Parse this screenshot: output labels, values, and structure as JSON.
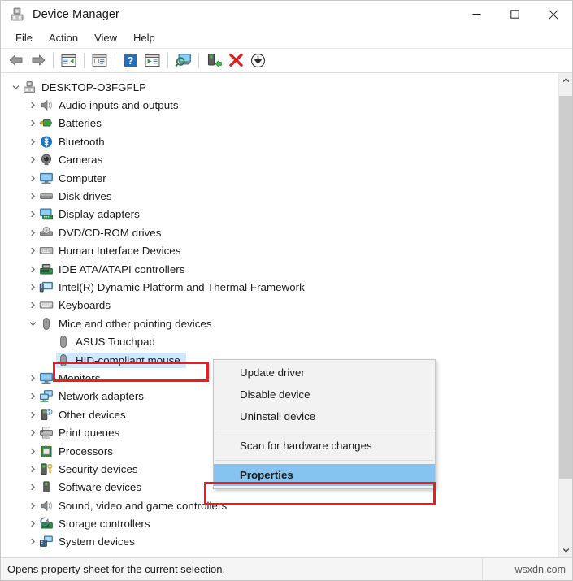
{
  "window": {
    "title": "Device Manager",
    "app_icon": "device-manager-icon",
    "caption": {
      "minimize": "minimize-icon",
      "maximize": "maximize-icon",
      "close": "close-icon"
    }
  },
  "menubar": {
    "items": [
      {
        "label": "File"
      },
      {
        "label": "Action"
      },
      {
        "label": "View"
      },
      {
        "label": "Help"
      }
    ]
  },
  "toolbar": {
    "buttons": [
      {
        "name": "back-icon",
        "tip": "Back"
      },
      {
        "name": "forward-icon",
        "tip": "Forward"
      },
      {
        "name": "show-hide-console-tree-icon",
        "tip": "Show/Hide Console Tree"
      },
      {
        "name": "properties-icon",
        "tip": "Properties"
      },
      {
        "name": "help-icon",
        "tip": "Help"
      },
      {
        "name": "update-driver-icon",
        "tip": "Update Driver"
      },
      {
        "name": "scan-for-hardware-changes-icon",
        "tip": "Scan for hardware changes"
      },
      {
        "name": "enable-device-icon",
        "tip": "Enable device"
      },
      {
        "name": "uninstall-device-icon",
        "tip": "Uninstall device"
      },
      {
        "name": "disable-device-icon",
        "tip": "Disable device"
      }
    ]
  },
  "tree": {
    "root": {
      "label": "DESKTOP-O3FGFLP",
      "icon": "computer-root-icon",
      "expanded": true
    },
    "nodes": [
      {
        "label": "Audio inputs and outputs",
        "icon": "speaker-icon",
        "depth": 1,
        "expanded": false
      },
      {
        "label": "Batteries",
        "icon": "battery-icon",
        "depth": 1,
        "expanded": false
      },
      {
        "label": "Bluetooth",
        "icon": "bluetooth-icon",
        "depth": 1,
        "expanded": false
      },
      {
        "label": "Cameras",
        "icon": "camera-icon",
        "depth": 1,
        "expanded": false
      },
      {
        "label": "Computer",
        "icon": "monitor-icon",
        "depth": 1,
        "expanded": false
      },
      {
        "label": "Disk drives",
        "icon": "disk-drive-icon",
        "depth": 1,
        "expanded": false
      },
      {
        "label": "Display adapters",
        "icon": "display-adapter-icon",
        "depth": 1,
        "expanded": false
      },
      {
        "label": "DVD/CD-ROM drives",
        "icon": "optical-drive-icon",
        "depth": 1,
        "expanded": false
      },
      {
        "label": "Human Interface Devices",
        "icon": "hid-icon",
        "depth": 1,
        "expanded": false
      },
      {
        "label": "IDE ATA/ATAPI controllers",
        "icon": "ide-controller-icon",
        "depth": 1,
        "expanded": false
      },
      {
        "label": "Intel(R) Dynamic Platform and Thermal Framework",
        "icon": "thermal-framework-icon",
        "depth": 1,
        "expanded": false
      },
      {
        "label": "Keyboards",
        "icon": "keyboard-icon",
        "depth": 1,
        "expanded": false
      },
      {
        "label": "Mice and other pointing devices",
        "icon": "mouse-icon",
        "depth": 1,
        "expanded": true
      },
      {
        "label": "ASUS Touchpad",
        "icon": "mouse-icon",
        "depth": 2,
        "expanded": null
      },
      {
        "label": "HID-compliant mouse",
        "icon": "mouse-icon",
        "depth": 2,
        "expanded": null,
        "selected": true
      },
      {
        "label": "Monitors",
        "icon": "monitor-icon",
        "depth": 1,
        "expanded": false
      },
      {
        "label": "Network adapters",
        "icon": "network-adapter-icon",
        "depth": 1,
        "expanded": false
      },
      {
        "label": "Other devices",
        "icon": "other-devices-icon",
        "depth": 1,
        "expanded": false
      },
      {
        "label": "Print queues",
        "icon": "printer-icon",
        "depth": 1,
        "expanded": false
      },
      {
        "label": "Processors",
        "icon": "processor-icon",
        "depth": 1,
        "expanded": false
      },
      {
        "label": "Security devices",
        "icon": "security-device-icon",
        "depth": 1,
        "expanded": false
      },
      {
        "label": "Software devices",
        "icon": "software-device-icon",
        "depth": 1,
        "expanded": false
      },
      {
        "label": "Sound, video and game controllers",
        "icon": "speaker-icon",
        "depth": 1,
        "expanded": false
      },
      {
        "label": "Storage controllers",
        "icon": "storage-controller-icon",
        "depth": 1,
        "expanded": false
      },
      {
        "label": "System devices",
        "icon": "system-device-icon",
        "depth": 1,
        "expanded": false
      }
    ]
  },
  "context_menu": {
    "items": [
      {
        "label": "Update driver",
        "type": "item"
      },
      {
        "label": "Disable device",
        "type": "item"
      },
      {
        "label": "Uninstall device",
        "type": "item"
      },
      {
        "type": "separator"
      },
      {
        "label": "Scan for hardware changes",
        "type": "item"
      },
      {
        "type": "separator"
      },
      {
        "label": "Properties",
        "type": "item",
        "highlighted": true,
        "bold": true
      }
    ]
  },
  "statusbar": {
    "text": "Opens property sheet for the current selection.",
    "watermark": "wsxdn.com"
  },
  "annotations": {
    "accent_color": "#ee1b1b",
    "selection_color": "#cde8ff",
    "menu_highlight_color": "#85c3f0",
    "boxes": [
      {
        "target": "HID-compliant mouse"
      },
      {
        "target": "Properties"
      }
    ]
  },
  "scrollbar": {
    "up_arrow": "chevron-up-icon",
    "down_arrow": "chevron-down-icon"
  }
}
